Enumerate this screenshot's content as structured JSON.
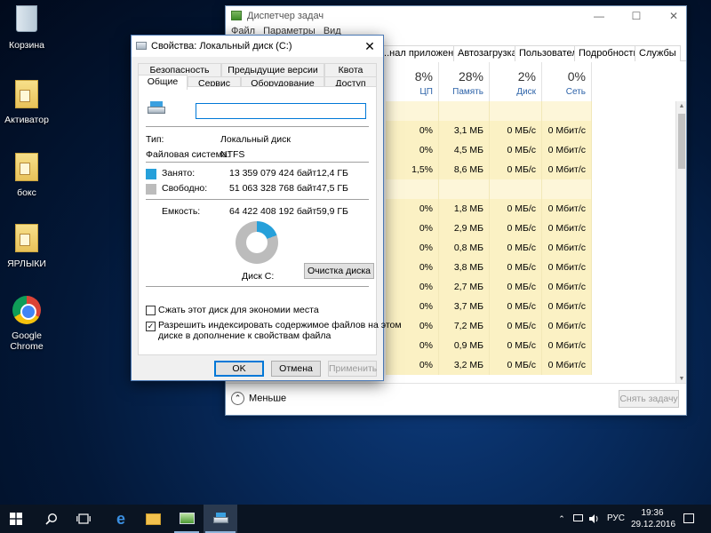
{
  "desktop": {
    "icons": [
      {
        "label": "Корзина",
        "icon": "recycle-bin-icon"
      },
      {
        "label": "Активатор",
        "icon": "folder-icon"
      },
      {
        "label": "бокс",
        "icon": "folder-icon"
      },
      {
        "label": "ЯРЛЫКИ",
        "icon": "folder-icon"
      },
      {
        "label": "Google Chrome",
        "icon": "chrome-icon"
      }
    ]
  },
  "task_manager": {
    "title": "Диспетчер задач",
    "menu": [
      "Файл",
      "Параметры",
      "Вид"
    ],
    "tabs": [
      "...нал приложений",
      "Автозагрузка",
      "Пользователи",
      "Подробности",
      "Службы"
    ],
    "columns": [
      {
        "percent": "8%",
        "name": "ЦП"
      },
      {
        "percent": "28%",
        "name": "Память"
      },
      {
        "percent": "2%",
        "name": "Диск"
      },
      {
        "percent": "0%",
        "name": "Сеть"
      }
    ],
    "rows": [
      {
        "cells": [
          "",
          "",
          "",
          ""
        ],
        "group": true
      },
      {
        "cells": [
          "0%",
          "3,1 МБ",
          "0 МБ/с",
          "0 Мбит/с"
        ]
      },
      {
        "cells": [
          "0%",
          "4,5 МБ",
          "0 МБ/с",
          "0 Мбит/с"
        ]
      },
      {
        "cells": [
          "1,5%",
          "8,6 МБ",
          "0 МБ/с",
          "0 Мбит/с"
        ]
      },
      {
        "cells": [
          "",
          "",
          "",
          ""
        ],
        "group": true
      },
      {
        "cells": [
          "0%",
          "1,8 МБ",
          "0 МБ/с",
          "0 Мбит/с"
        ]
      },
      {
        "cells": [
          "0%",
          "2,9 МБ",
          "0 МБ/с",
          "0 Мбит/с"
        ]
      },
      {
        "cells": [
          "0%",
          "0,8 МБ",
          "0 МБ/с",
          "0 Мбит/с"
        ]
      },
      {
        "cells": [
          "0%",
          "3,8 МБ",
          "0 МБ/с",
          "0 Мбит/с"
        ]
      },
      {
        "cells": [
          "0%",
          "2,7 МБ",
          "0 МБ/с",
          "0 Мбит/с"
        ]
      },
      {
        "cells": [
          "0%",
          "3,7 МБ",
          "0 МБ/с",
          "0 Мбит/с"
        ]
      },
      {
        "cells": [
          "0%",
          "7,2 МБ",
          "0 МБ/с",
          "0 Мбит/с"
        ]
      },
      {
        "cells": [
          "0%",
          "0,9 МБ",
          "0 МБ/с",
          "0 Мбит/с"
        ]
      },
      {
        "cells": [
          "0%",
          "3,2 МБ",
          "0 МБ/с",
          "0 Мбит/с"
        ]
      }
    ],
    "fewer_label": "Меньше",
    "end_task_label": "Снять задачу"
  },
  "dialog": {
    "title": "Свойства: Локальный диск (C:)",
    "close": "✕",
    "tabs_back": [
      "Безопасность",
      "Предыдущие версии",
      "Квота"
    ],
    "tabs_front": [
      "Общие",
      "Сервис",
      "Оборудование",
      "Доступ"
    ],
    "drive_name_value": "",
    "type_label": "Тип:",
    "type_value": "Локальный диск",
    "fs_label": "Файловая система:",
    "fs_value": "NTFS",
    "used_label": "Занято:",
    "used_bytes": "13 359 079 424 байт",
    "used_size": "12,4 ГБ",
    "free_label": "Свободно:",
    "free_bytes": "51 063 328 768 байт",
    "free_size": "47,5 ГБ",
    "capacity_label": "Емкость:",
    "capacity_bytes": "64 422 408 192 байт",
    "capacity_size": "59,9 ГБ",
    "used_fraction": 0.194,
    "disk_label": "Диск C:",
    "cleanup_button": "Очистка диска",
    "compress_label": "Сжать этот диск для экономии места",
    "compress_checked": false,
    "index_label_line1": "Разрешить индексировать содержимое файлов на этом",
    "index_label_line2": "диске в дополнение к свойствам файла",
    "index_checked": true,
    "ok": "OK",
    "cancel": "Отмена",
    "apply": "Применить",
    "colors": {
      "used": "#26a0da",
      "free": "#bcbcbc"
    }
  },
  "taskbar": {
    "language": "РУС",
    "time": "19:36",
    "date": "29.12.2016",
    "icons": [
      "windows-start-icon",
      "search-icon",
      "task-view-icon",
      "edge-icon",
      "file-explorer-icon",
      "task-manager-icon",
      "drive-properties-icon"
    ]
  }
}
